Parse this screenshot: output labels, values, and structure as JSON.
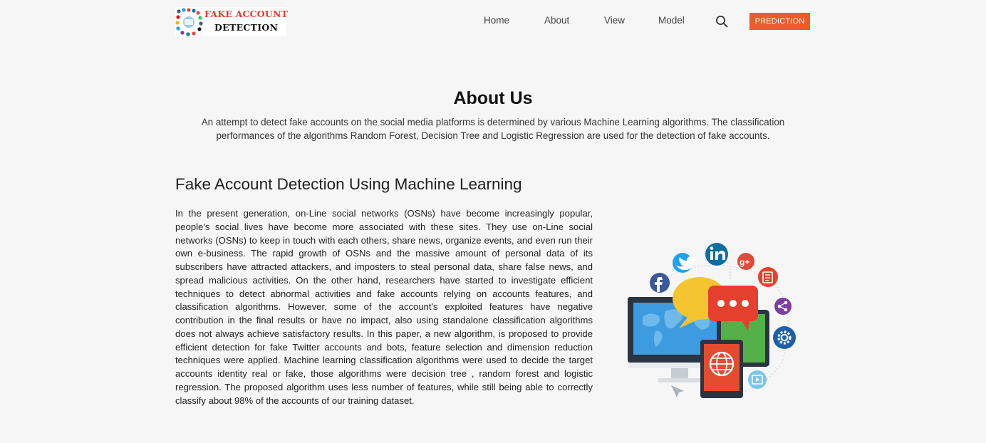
{
  "logo": {
    "line1": "FAKE ACCOUNT",
    "line2": "DETECTION"
  },
  "nav": {
    "home": "Home",
    "about": "About",
    "view": "View",
    "model": "Model",
    "search_icon": "search-icon",
    "prediction_button": "PREDICTION"
  },
  "about": {
    "title": "About Us",
    "description": "An attempt to detect fake accounts on the social media platforms is determined by various Machine Learning algorithms. The classification performances of the algorithms Random Forest, Decision Tree and Logistic Regression are used for the detection of fake accounts."
  },
  "section": {
    "title": "Fake Account Detection Using Machine Learning",
    "body": "In the present generation, on-Line social networks (OSNs) have become increasingly popular, people's social lives have become more associated with these sites. They use on-Line social networks (OSNs) to keep in touch with each others, share news, organize events, and even run their own e-business. The rapid growth of OSNs and the massive amount of personal data of its subscribers have attracted attackers, and imposters to steal personal data, share false news, and spread malicious activities. On the other hand, researchers have started to investigate efficient techniques to detect abnormal activities and fake accounts relying on accounts features, and classification algorithms. However, some of the account's exploited features have negative contribution in the final results or have no impact, also using standalone classification algorithms does not always achieve satisfactory results. In this paper, a new algorithm, is proposed to provide efficient detection for fake Twitter accounts and bots, feature selection and dimension reduction techniques were applied. Machine learning classification algorithms were used to decide the target accounts identity real or fake, those algorithms were decision tree , random forest and logistic regression. The proposed algorithm uses less number of features, while still being able to correctly classify about 98% of the accounts of our training dataset."
  },
  "illustration": {
    "icons": [
      "twitter-icon",
      "linkedin-icon",
      "google-plus-icon",
      "facebook-icon",
      "notes-icon",
      "share-icon",
      "settings-icon",
      "globe-icon",
      "video-icon",
      "chat-bubble-icon",
      "monitor-icon",
      "tablet-icon",
      "cursor-icon"
    ]
  },
  "colors": {
    "accent": "#f05a2a",
    "logo_red": "#e53a2b",
    "background": "#f6f6f6"
  }
}
